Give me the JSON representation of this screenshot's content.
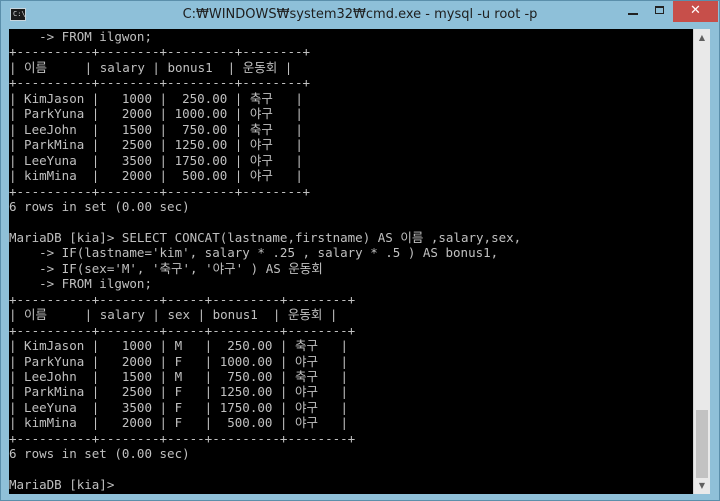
{
  "window": {
    "title": "C:₩WINDOWS₩system32₩cmd.exe - mysql  -u root -p",
    "icon_label": "C:\\",
    "icon": "cmd-icon",
    "close_label": "✕"
  },
  "colors": {
    "console_bg": "#000000",
    "console_text": "#c0c0c0",
    "titlebar": "#8ec0d9",
    "close_button": "#c74f4a"
  },
  "console": {
    "lines": [
      "    -> FROM ilgwon;",
      "+----------+--------+---------+--------+",
      "| 이름     | salary | bonus1  | 운동회 |",
      "+----------+--------+---------+--------+",
      "| KimJason |   1000 |  250.00 | 축구   |",
      "| ParkYuna |   2000 | 1000.00 | 야구   |",
      "| LeeJohn  |   1500 |  750.00 | 축구   |",
      "| ParkMina |   2500 | 1250.00 | 야구   |",
      "| LeeYuna  |   3500 | 1750.00 | 야구   |",
      "| kimMina  |   2000 |  500.00 | 야구   |",
      "+----------+--------+---------+--------+",
      "6 rows in set (0.00 sec)",
      "",
      "MariaDB [kia]> SELECT CONCAT(lastname,firstname) AS 이름 ,salary,sex,",
      "    -> IF(lastname='kim', salary * .25 , salary * .5 ) AS bonus1,",
      "    -> IF(sex='M', '축구', '야구' ) AS 운동회",
      "    -> FROM ilgwon;",
      "+----------+--------+-----+---------+--------+",
      "| 이름     | salary | sex | bonus1  | 운동회 |",
      "+----------+--------+-----+---------+--------+",
      "| KimJason |   1000 | M   |  250.00 | 축구   |",
      "| ParkYuna |   2000 | F   | 1000.00 | 야구   |",
      "| LeeJohn  |   1500 | M   |  750.00 | 축구   |",
      "| ParkMina |   2500 | F   | 1250.00 | 야구   |",
      "| LeeYuna  |   3500 | F   | 1750.00 | 야구   |",
      "| kimMina  |   2000 | F   |  500.00 | 야구   |",
      "+----------+--------+-----+---------+--------+",
      "6 rows in set (0.00 sec)",
      "",
      "MariaDB [kia]>"
    ]
  },
  "scrollbar": {
    "up_arrow": "▲",
    "down_arrow": "▼"
  }
}
